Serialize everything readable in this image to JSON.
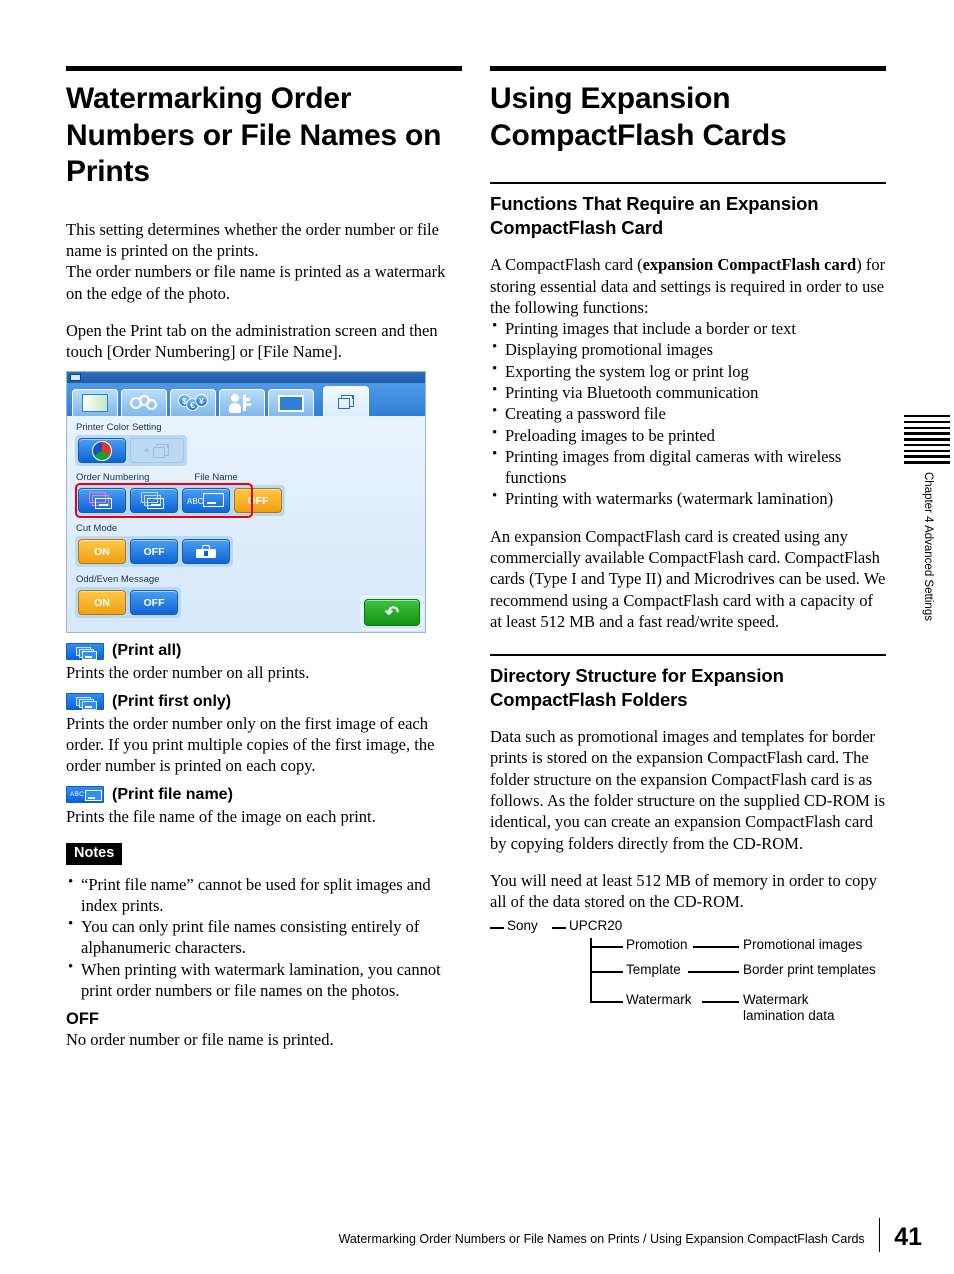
{
  "left": {
    "title": "Watermarking Order Numbers or File Names on Prints",
    "intro_1": "This setting determines whether the order number or file name is printed on the prints.",
    "intro_2": "The order numbers or file name is printed as a watermark on the edge of the photo.",
    "intro_3": "Open the Print tab on the administration screen and then touch [Order Numbering] or [File Name].",
    "legend": [
      {
        "icon": "print-all-icon",
        "label": "(Print all)",
        "desc": "Prints the order number on all prints."
      },
      {
        "icon": "print-first-only-icon",
        "label": "(Print first only)",
        "desc": "Prints the order number only on the first image of each order. If you print multiple copies of the first image, the order number is printed on each copy."
      },
      {
        "icon": "print-file-name-icon",
        "label": "(Print file name)",
        "desc": "Prints the file name of the image on each print."
      }
    ],
    "notes_title": "Notes",
    "notes": [
      "“Print file name” cannot be used for split images and index prints.",
      "You can only print file names consisting entirely of alphanumeric characters.",
      "When printing with watermark lamination, you cannot print order numbers or file names on the photos."
    ],
    "off_heading": "OFF",
    "off_desc": "No order number or file name is printed."
  },
  "ui_screenshot": {
    "tabs": [
      {
        "name": "image-quality-tab",
        "icon": "gradient-image-icon"
      },
      {
        "name": "settings-tab",
        "icon": "gears-icon"
      },
      {
        "name": "currency-tab",
        "icon": "currency-coins-icon"
      },
      {
        "name": "user-access-tab",
        "icon": "person-key-icon"
      },
      {
        "name": "display-tab",
        "icon": "frame-icon"
      },
      {
        "name": "print-tab",
        "icon": "print-box-icon",
        "active": true
      }
    ],
    "groups": [
      {
        "label": "Printer Color Setting",
        "buttons": [
          {
            "name": "color-wheel-button",
            "icon": "color-wheel-icon",
            "state": "selected"
          },
          {
            "name": "add-printer-button",
            "icon": "plus-box-icon",
            "state": "disabled"
          }
        ]
      }
    ],
    "order_numbering_label": "Order Numbering",
    "file_name_label": "File Name",
    "order_buttons": [
      {
        "name": "print-all-button",
        "icon": "pages-magenta-icon"
      },
      {
        "name": "print-first-only-button",
        "icon": "pages-icon"
      },
      {
        "name": "print-file-name-button",
        "icon": "abc-box-icon"
      }
    ],
    "off_button": "OFF",
    "cut_mode_label": "Cut Mode",
    "cut_mode_buttons": [
      "ON",
      "OFF"
    ],
    "cut_mode_tool_icon": "toolbox-icon",
    "odd_even_label": "Odd/Even Message",
    "odd_even_buttons": [
      "ON",
      "OFF"
    ],
    "return_button_icon": "return-arrow-icon",
    "highlight_color": "#e60012"
  },
  "right": {
    "title": "Using Expansion CompactFlash Cards",
    "section1_title": "Functions That Require an Expansion CompactFlash Card",
    "section1_p1_a": "A CompactFlash card (",
    "section1_p1_bold": "expansion CompactFlash card",
    "section1_p1_b": ") for storing essential data and settings is required in order to use the following functions:",
    "section1_bullets": [
      "Printing images that include a border or text",
      "Displaying promotional images",
      "Exporting the system log or print log",
      "Printing via Bluetooth communication",
      "Creating a password file",
      "Preloading images to be printed",
      "Printing images from digital cameras with wireless functions",
      "Printing with watermarks (watermark lamination)"
    ],
    "section1_p2": "An expansion CompactFlash card is created using any commercially available CompactFlash card. CompactFlash cards (Type I and Type II) and Microdrives can be used. We recommend using a CompactFlash card with a capacity of at least 512 MB and a fast read/write speed.",
    "section2_title": "Directory Structure for Expansion CompactFlash Folders",
    "section2_p1": "Data such as promotional images and templates for border prints is stored on the expansion CompactFlash card. The folder structure on the expansion CompactFlash card is as follows. As the folder structure on the supplied CD-ROM is identical, you can create an expansion CompactFlash card by copying folders directly from the CD-ROM.",
    "section2_p2": "You will need at least 512 MB of memory in order to copy all of the data stored on the CD-ROM.",
    "tree": {
      "root": "Sony",
      "level1": "UPCR20",
      "children": [
        {
          "folder": "Promotion",
          "desc": "Promotional images"
        },
        {
          "folder": "Template",
          "desc": "Border print templates"
        },
        {
          "folder": "Watermark",
          "desc": "Watermark lamination data"
        }
      ]
    }
  },
  "side_tab": {
    "text": "Chapter 4  Advanced Settings"
  },
  "footer": {
    "text": "Watermarking Order Numbers or File Names on Prints / Using Expansion CompactFlash Cards",
    "page": "41"
  }
}
